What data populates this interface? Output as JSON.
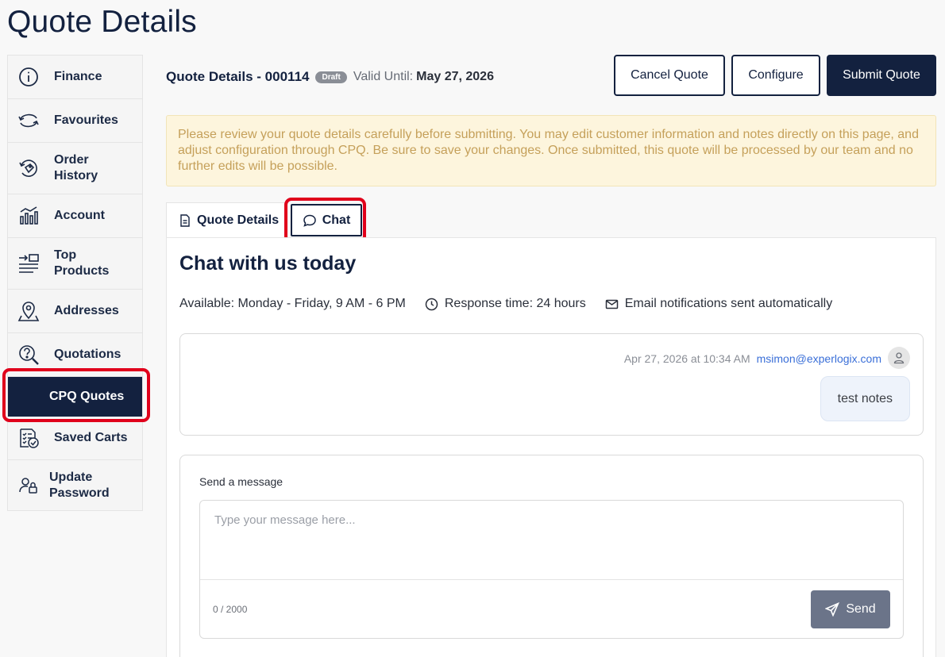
{
  "page": {
    "title": "Quote Details"
  },
  "sidebar": {
    "items": [
      {
        "label": "Finance",
        "icon": "info-circle-icon"
      },
      {
        "label": "Favourites",
        "icon": "refresh-arrows-icon"
      },
      {
        "label": "Order History",
        "icon": "history-tag-icon"
      },
      {
        "label": "Account",
        "icon": "chart-bars-icon"
      },
      {
        "label": "Top Products",
        "icon": "list-arrow-icon"
      },
      {
        "label": "Addresses",
        "icon": "map-pin-icon"
      },
      {
        "label": "Quotations",
        "icon": "magnify-question-icon"
      },
      {
        "label": "CPQ Quotes",
        "icon": "none",
        "active": true
      },
      {
        "label": "Saved Carts",
        "icon": "checklist-icon"
      },
      {
        "label": "Update Password",
        "icon": "user-lock-icon"
      }
    ]
  },
  "header": {
    "title": "Quote Details - 000114",
    "badge": "Draft",
    "valid_label": "Valid Until:",
    "valid_date": "May 27, 2026",
    "cancel_label": "Cancel Quote",
    "configure_label": "Configure",
    "submit_label": "Submit Quote"
  },
  "notice": {
    "text": "Please review your quote details carefully before submitting. You may edit customer information and notes directly on this page, and adjust configuration through CPQ. Be sure to save your changes. Once submitted, this quote will be processed by our team and no further edits will be possible."
  },
  "tabs": {
    "details": "Quote Details",
    "chat": "Chat"
  },
  "chat": {
    "heading": "Chat with us today",
    "availability": "Available: Monday - Friday, 9 AM - 6 PM",
    "response_time": "Response time: 24 hours",
    "email_notice": "Email notifications sent automatically",
    "messages": [
      {
        "timestamp": "Apr 27, 2026 at 10:34 AM",
        "author": "msimon@experlogix.com",
        "text": "test notes"
      }
    ],
    "composer": {
      "label": "Send a message",
      "placeholder": "Type your message here...",
      "value": "",
      "counter": "0 / 2000",
      "send_label": "Send"
    }
  },
  "colors": {
    "navy": "#13213f",
    "highlight": "#e0001b",
    "notice_bg": "#fdf5dd",
    "notice_text": "#c5a05a",
    "send_btn": "#6b7489",
    "link": "#3a6fd8"
  }
}
